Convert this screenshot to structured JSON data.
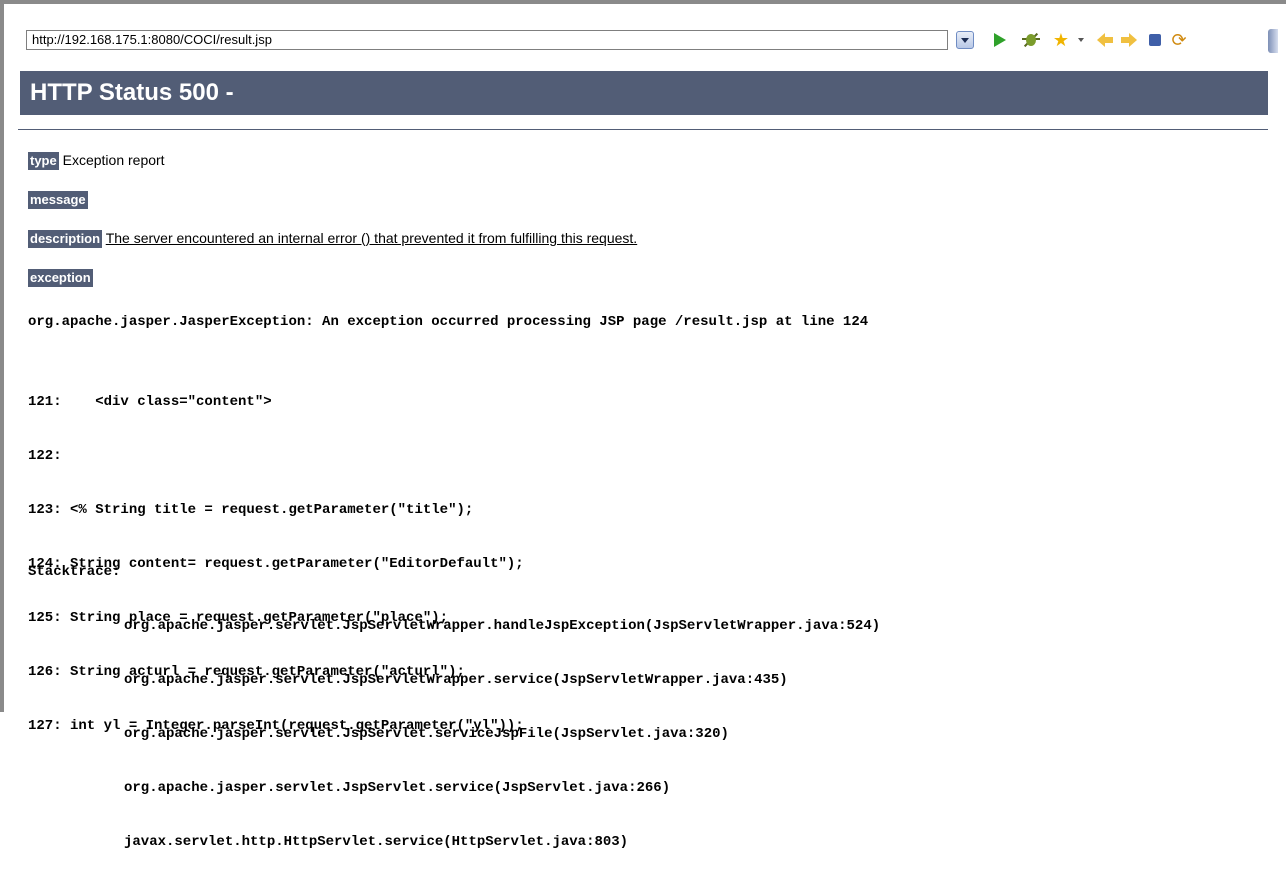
{
  "browser": {
    "url": "http://192.168.175.1:8080/COCI/result.jsp"
  },
  "page": {
    "title": "HTTP Status 500 -",
    "type_label": "type",
    "type_value": "Exception report",
    "message_label": "message",
    "description_label": "description",
    "description_value": "The server encountered an internal error () that prevented it from fulfilling this request.",
    "exception_label": "exception",
    "exception_line": "org.apache.jasper.JasperException: An exception occurred processing JSP page /result.jsp at line 124",
    "code_lines": [
      "121:    <div class=\"content\">",
      "122:",
      "123: <% String title = request.getParameter(\"title\");",
      "124: String content= request.getParameter(\"EditorDefault\");",
      "125: String place = request.getParameter(\"place\");",
      "126: String acturl = request.getParameter(\"acturl\");",
      "127: int yl = Integer.parseInt(request.getParameter(\"yl\"));"
    ],
    "stacktrace_label": "Stacktrace:",
    "stack_lines": [
      "org.apache.jasper.servlet.JspServletWrapper.handleJspException(JspServletWrapper.java:524)",
      "org.apache.jasper.servlet.JspServletWrapper.service(JspServletWrapper.java:435)",
      "org.apache.jasper.servlet.JspServlet.serviceJspFile(JspServlet.java:320)",
      "org.apache.jasper.servlet.JspServlet.service(JspServlet.java:266)",
      "javax.servlet.http.HttpServlet.service(HttpServlet.java:803)"
    ]
  },
  "colors": {
    "header_bg": "#525d76",
    "header_text": "#ffffff"
  },
  "icons": [
    "dropdown-icon",
    "go-icon",
    "debug-icon",
    "favorite-star-icon",
    "back-arrow-icon",
    "forward-arrow-icon",
    "stop-icon",
    "refresh-icon"
  ]
}
